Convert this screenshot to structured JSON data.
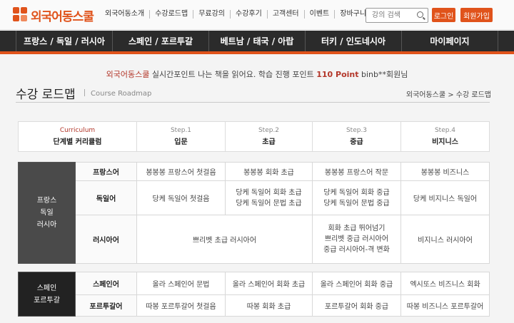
{
  "brand": {
    "name": "외국어동스쿨",
    "color": "#e0531b"
  },
  "top_nav": [
    "외국어동소개",
    "수강로드맵",
    "무료강의",
    "수강후기",
    "고객센터",
    "이벤트",
    "장바구니"
  ],
  "search": {
    "placeholder": "강의 검색",
    "icon": "search-icon"
  },
  "auth": {
    "login": "로그인",
    "join": "회원가입"
  },
  "main_nav": [
    "프랑스 / 독일 / 러시아",
    "스페인 / 포르투갈",
    "베트남 / 태국 / 아랍",
    "터키 / 인도네시아",
    "마이페이지"
  ],
  "notice": {
    "brand": "외국어동스쿨",
    "pre": " 실시간포인트 나는 책을 읽어요. 학습 진행 포인트 ",
    "points": "110 Point",
    "post": " binb**회원님"
  },
  "page": {
    "title": "수강 로드맵",
    "subtitle": "Course Roadmap",
    "breadcrumb": "외국어동스쿨 > 수강 로드맵"
  },
  "header": [
    {
      "top": "Curriculum",
      "bottom": "단계별 커리큘럼"
    },
    {
      "top": "Step.1",
      "bottom": "입문"
    },
    {
      "top": "Step.2",
      "bottom": "초급"
    },
    {
      "top": "Step.3",
      "bottom": "중급"
    },
    {
      "top": "Step.4",
      "bottom": "비지니스"
    }
  ],
  "group_a": {
    "name_lines": [
      "프랑스",
      "독일",
      "러시아"
    ],
    "color": "#4a4a4a",
    "rows": [
      {
        "lang": "프랑스어",
        "cells": [
          "봉봉봉 프랑스어 첫걸음",
          "봉봉봉 회화 초급",
          "봉봉봉 프랑스어 작문",
          "봉봉봉 비즈니스"
        ]
      },
      {
        "lang": "독일어",
        "cells": [
          "당케 독일어 첫걸음",
          [
            "당케 독일어 회화 초급",
            "당케 독일어 문법 초급"
          ],
          [
            "당케 독일어 회화 중급",
            "당케 독일어 문법 중급"
          ],
          "당케 비지니스 독일어"
        ]
      },
      {
        "lang": "러시아어",
        "merged": "쁘리벳 초급 러시아어",
        "step3": [
          "회화 초급 뛰어넘기",
          "쁘리벳 중급 러시아어",
          "중급 러시아어-격 변화"
        ],
        "step4": "비지니스 러시아어"
      }
    ]
  },
  "group_b": {
    "name_lines": [
      "스페인",
      "포르투갈"
    ],
    "color": "#222222",
    "rows": [
      {
        "lang": "스페인어",
        "cells": [
          "올라 스페인어 문법",
          "올라 스페인어 회화 초급",
          "올라 스페인어 회화 중급",
          "엑시또스 비즈니스 회화"
        ]
      },
      {
        "lang": "포르투갈어",
        "cells": [
          "따봉 포르투갈어 첫걸음",
          "따봉 회화 초급",
          "포르투갈어 회화 중급",
          "따봉 비즈니스 포르투갈어"
        ]
      }
    ]
  }
}
